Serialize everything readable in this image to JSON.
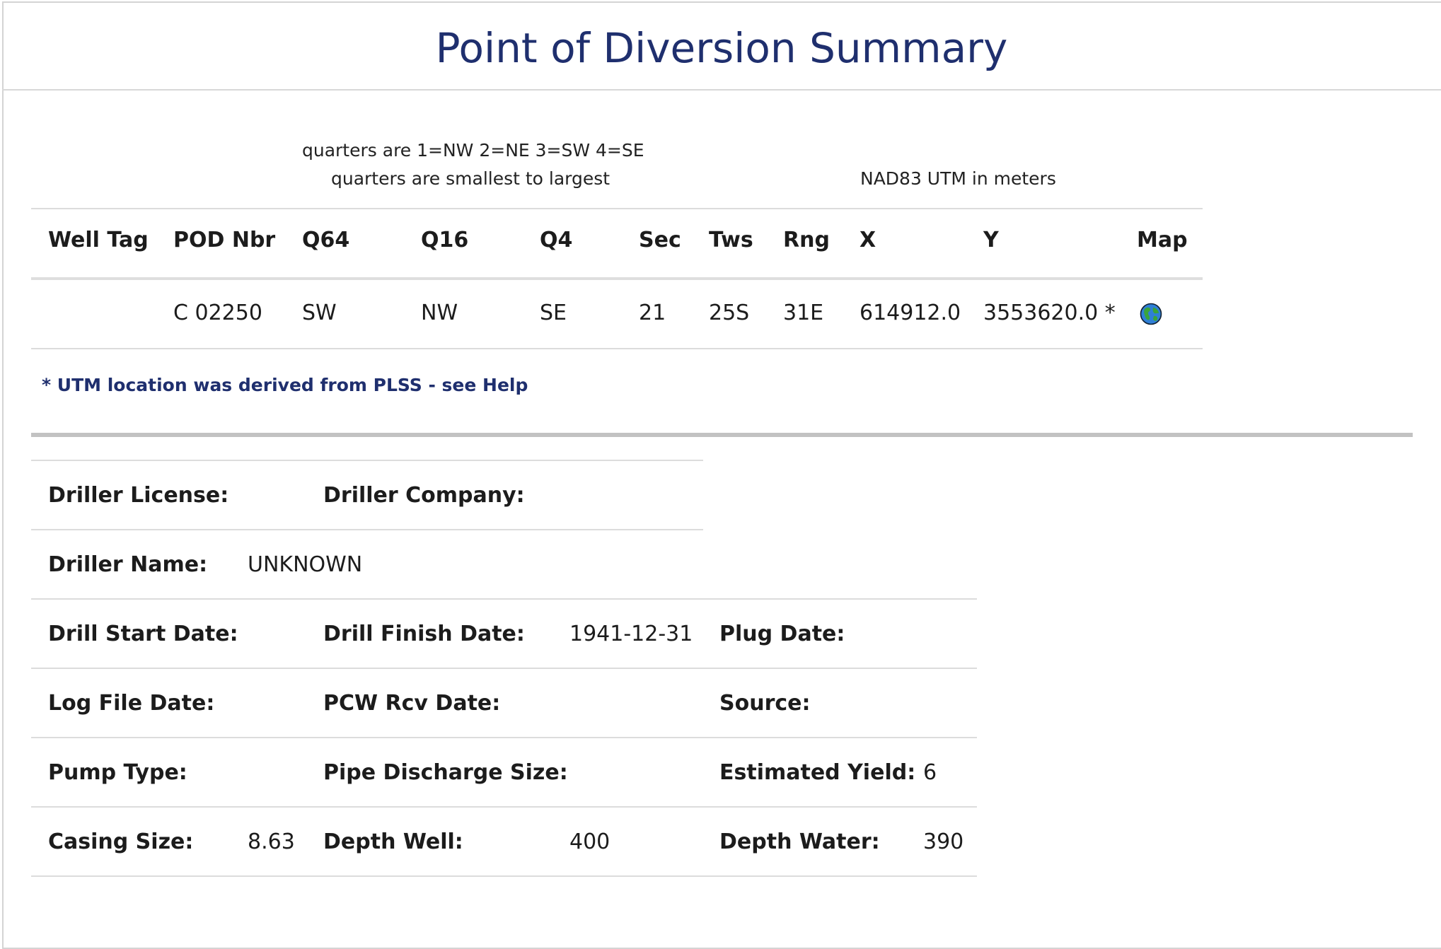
{
  "title": "Point of Diversion Summary",
  "notes": {
    "quarters_line1": "quarters are 1=NW 2=NE 3=SW 4=SE",
    "quarters_line2": "quarters are smallest to largest",
    "utm": "NAD83 UTM in meters"
  },
  "pod_table": {
    "headers": [
      "Well Tag",
      "POD Nbr",
      "Q64",
      "Q16",
      "Q4",
      "Sec",
      "Tws",
      "Rng",
      "X",
      "Y",
      "Map"
    ],
    "row": {
      "well_tag": "",
      "pod_nbr": "C 02250",
      "q64": "SW",
      "q16": "NW",
      "q4": "SE",
      "sec": "21",
      "tws": "25S",
      "rng": "31E",
      "x": "614912.0",
      "y": "3553620.0 *",
      "map_icon": "globe-icon"
    }
  },
  "footnote": "* UTM location was derived from PLSS - see Help",
  "details": {
    "driller_license_label": "Driller License:",
    "driller_license": "",
    "driller_company_label": "Driller Company:",
    "driller_company": "",
    "driller_name_label": "Driller Name:",
    "driller_name": "UNKNOWN",
    "drill_start_label": "Drill Start Date:",
    "drill_start": "",
    "drill_finish_label": "Drill Finish Date:",
    "drill_finish": "1941-12-31",
    "plug_date_label": "Plug Date:",
    "plug_date": "",
    "log_file_label": "Log File Date:",
    "log_file": "",
    "pcw_rcv_label": "PCW Rcv Date:",
    "pcw_rcv": "",
    "source_label": "Source:",
    "source": "",
    "pump_type_label": "Pump Type:",
    "pump_type": "",
    "pipe_discharge_label": "Pipe Discharge Size:",
    "pipe_discharge": "",
    "estimated_yield_label": "Estimated Yield:",
    "estimated_yield": "6",
    "casing_size_label": "Casing Size:",
    "casing_size": "8.63",
    "depth_well_label": "Depth Well:",
    "depth_well": "400",
    "depth_water_label": "Depth Water:",
    "depth_water": "390"
  },
  "colors": {
    "title": "#1f2f6e",
    "footnote": "#1f2f6e",
    "rule": "#dcdcdc",
    "thick_rule": "#c2c2c2"
  }
}
